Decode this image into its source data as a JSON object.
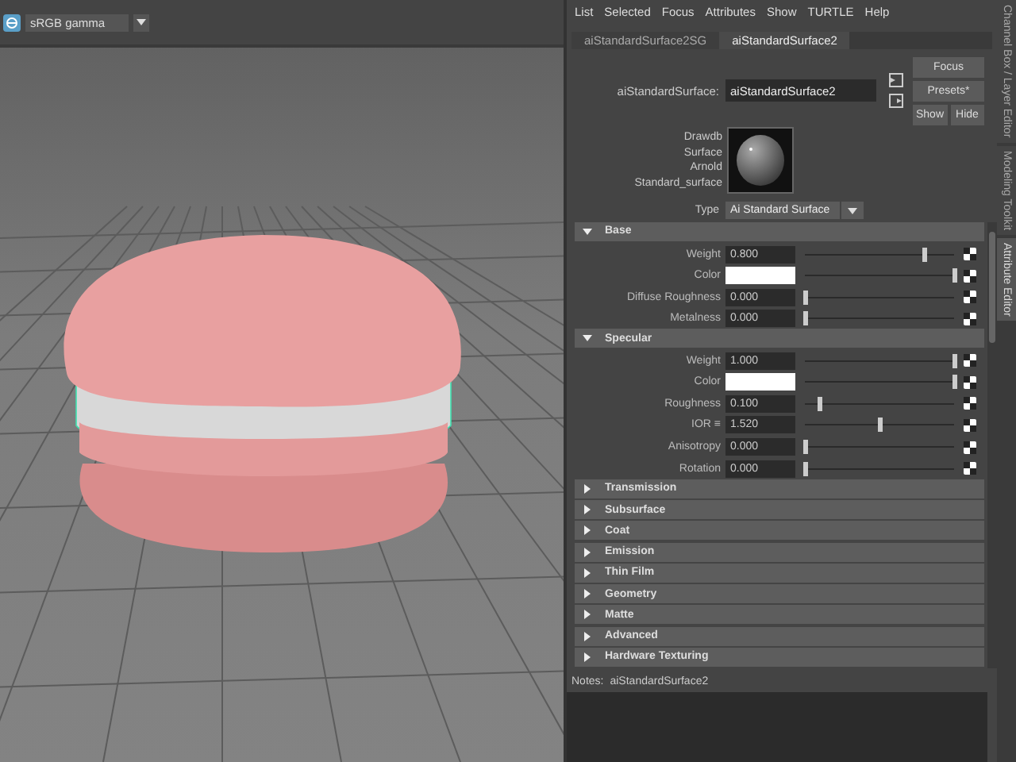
{
  "viewport": {
    "colorspace": "sRGB gamma"
  },
  "menu": [
    "List",
    "Selected",
    "Focus",
    "Attributes",
    "Show",
    "TURTLE",
    "Help"
  ],
  "tabs": [
    {
      "label": "aiStandardSurface2SG",
      "selected": false
    },
    {
      "label": "aiStandardSurface2",
      "selected": true
    }
  ],
  "node_field": {
    "label": "aiStandardSurface:",
    "value": "aiStandardSurface2"
  },
  "buttons": [
    "Focus",
    "Presets*",
    "Show",
    "Hide"
  ],
  "swatch_labels": [
    "Drawdb",
    "Surface",
    "Arnold",
    "Standard_surface"
  ],
  "type_field": {
    "label": "Type",
    "value": "Ai Standard Surface"
  },
  "sections": [
    {
      "title": "Base",
      "expanded": true,
      "rows": [
        {
          "kind": "number",
          "label": "Weight",
          "value": "0.800",
          "level": 0.8
        },
        {
          "kind": "color",
          "label": "Color",
          "color": "#ffffff",
          "level": 1
        },
        {
          "kind": "number",
          "label": "Diffuse Roughness",
          "value": "0.000",
          "level": 0
        },
        {
          "kind": "number",
          "label": "Metalness",
          "value": "0.000",
          "level": 0
        }
      ]
    },
    {
      "title": "Specular",
      "expanded": true,
      "rows": [
        {
          "kind": "number",
          "label": "Weight",
          "value": "1.000",
          "level": 1
        },
        {
          "kind": "color",
          "label": "Color",
          "color": "#ffffff",
          "level": 1
        },
        {
          "kind": "number",
          "label": "Roughness",
          "value": "0.100",
          "level": 0.1
        },
        {
          "kind": "number",
          "label": "IOR ≡",
          "value": "1.520",
          "level": 0.5
        },
        {
          "kind": "number",
          "label": "Anisotropy",
          "value": "0.000",
          "level": 0
        },
        {
          "kind": "number",
          "label": "Rotation",
          "value": "0.000",
          "level": 0
        }
      ]
    },
    {
      "title": "Transmission",
      "expanded": false
    },
    {
      "title": "Subsurface",
      "expanded": false
    },
    {
      "title": "Coat",
      "expanded": false
    },
    {
      "title": "Emission",
      "expanded": false
    },
    {
      "title": "Thin Film",
      "expanded": false
    },
    {
      "title": "Geometry",
      "expanded": false
    },
    {
      "title": "Matte",
      "expanded": false
    },
    {
      "title": "Advanced",
      "expanded": false
    },
    {
      "title": "Hardware Texturing",
      "expanded": false
    }
  ],
  "notes": {
    "label": "Notes:",
    "value": "aiStandardSurface2"
  },
  "side_tabs": [
    {
      "label": "Channel Box / Layer Editor",
      "selected": false
    },
    {
      "label": "Modeling Toolkit",
      "selected": false
    },
    {
      "label": "Attribute Editor",
      "selected": true
    }
  ]
}
